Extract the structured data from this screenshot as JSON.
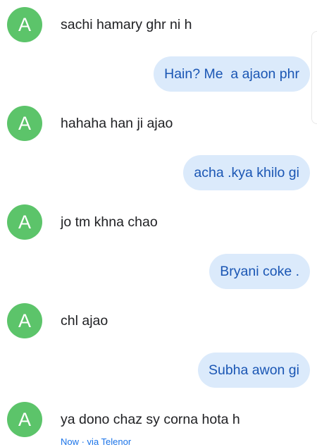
{
  "colors": {
    "avatar_bg": "#5cc46a",
    "outgoing_bubble_bg": "#dbeafb",
    "outgoing_text": "#1a56b4",
    "incoming_text": "#202124"
  },
  "contact": {
    "avatar_letter": "A"
  },
  "messages": [
    {
      "direction": "incoming",
      "text": "sachi hamary ghr ni h"
    },
    {
      "direction": "outgoing",
      "text": "Hain? Me  a ajaon phr"
    },
    {
      "direction": "incoming",
      "text": "hahaha han ji ajao"
    },
    {
      "direction": "outgoing",
      "text": "acha .kya khilo gi"
    },
    {
      "direction": "incoming",
      "text": "jo tm khna chao"
    },
    {
      "direction": "outgoing",
      "text": "Bryani coke ."
    },
    {
      "direction": "incoming",
      "text": "chl ajao"
    },
    {
      "direction": "outgoing",
      "text": "Subha awon gi"
    },
    {
      "direction": "incoming",
      "text": "ya dono chaz sy corna hota h"
    }
  ],
  "footer": {
    "status": "Now · via Telenor"
  }
}
